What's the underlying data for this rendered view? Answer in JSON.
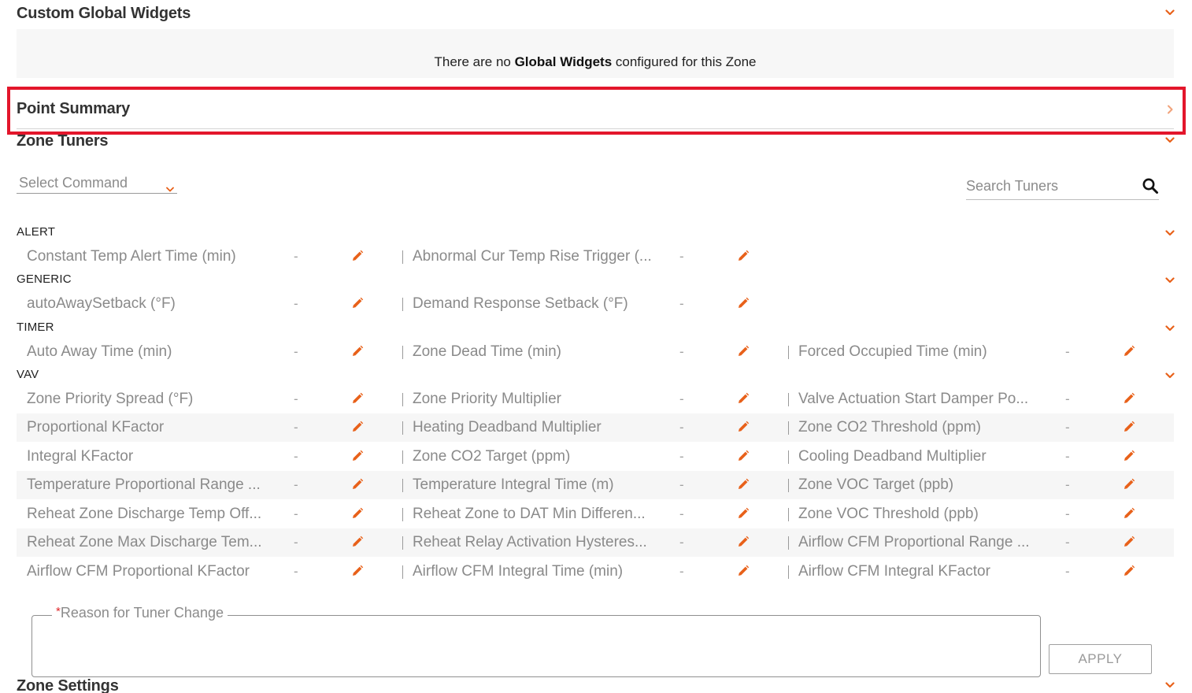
{
  "sections": {
    "global_widgets": {
      "title": "Custom Global Widgets",
      "empty_prefix": "There are no ",
      "empty_bold": "Global Widgets",
      "empty_suffix": " configured for this Zone"
    },
    "point_summary": {
      "title": "Point Summary"
    },
    "zone_tuners": {
      "title": "Zone Tuners"
    },
    "zone_settings": {
      "title": "Zone Settings"
    }
  },
  "toolbar": {
    "select_command": "Select Command",
    "search_placeholder": "Search Tuners"
  },
  "groups": {
    "alert": "ALERT",
    "generic": "GENERIC",
    "timer": "TIMER",
    "vav": "VAV"
  },
  "rows": {
    "alert_0": {
      "c1": "Constant Temp Alert Time (min)",
      "v1": "-",
      "c2": "Abnormal Cur Temp Rise Trigger (...",
      "v2": "-"
    },
    "generic_0": {
      "c1": "autoAwaySetback (°F)",
      "v1": "-",
      "c2": "Demand Response Setback (°F)",
      "v2": "-"
    },
    "timer_0": {
      "c1": "Auto Away Time (min)",
      "v1": "-",
      "c2": "Zone Dead Time (min)",
      "v2": "-",
      "c3": "Forced Occupied Time (min)",
      "v3": "-"
    },
    "vav_0": {
      "c1": "Zone Priority Spread (°F)",
      "v1": "-",
      "c2": "Zone Priority Multiplier",
      "v2": "-",
      "c3": "Valve Actuation Start Damper Po...",
      "v3": "-"
    },
    "vav_1": {
      "c1": "Proportional KFactor",
      "v1": "-",
      "c2": "Heating Deadband Multiplier",
      "v2": "-",
      "c3": "Zone CO2 Threshold (ppm)",
      "v3": "-"
    },
    "vav_2": {
      "c1": "Integral KFactor",
      "v1": "-",
      "c2": "Zone CO2 Target (ppm)",
      "v2": "-",
      "c3": "Cooling Deadband Multiplier",
      "v3": "-"
    },
    "vav_3": {
      "c1": "Temperature Proportional Range ...",
      "v1": "-",
      "c2": "Temperature Integral Time (m)",
      "v2": "-",
      "c3": "Zone VOC Target (ppb)",
      "v3": "-"
    },
    "vav_4": {
      "c1": "Reheat Zone Discharge Temp Off...",
      "v1": "-",
      "c2": "Reheat Zone to DAT Min Differen...",
      "v2": "-",
      "c3": "Zone VOC Threshold (ppb)",
      "v3": "-"
    },
    "vav_5": {
      "c1": "Reheat Zone Max Discharge Tem...",
      "v1": "-",
      "c2": "Reheat Relay Activation Hysteres...",
      "v2": "-",
      "c3": "Airflow CFM Proportional Range ...",
      "v3": "-"
    },
    "vav_6": {
      "c1": "Airflow CFM Proportional KFactor",
      "v1": "-",
      "c2": "Airflow CFM Integral Time (min)",
      "v2": "-",
      "c3": "Airflow CFM Integral KFactor",
      "v3": "-"
    }
  },
  "reason": {
    "required_mark": "*",
    "label": "Reason for Tuner Change"
  },
  "apply_label": "APPLY",
  "icons": {
    "section_expanded": "chevron-down-icon",
    "section_collapsed": "chevron-right-icon",
    "search": "search-icon",
    "edit": "pencil-icon"
  },
  "colors": {
    "accent": "#e8611a",
    "highlight": "#e3162b"
  }
}
